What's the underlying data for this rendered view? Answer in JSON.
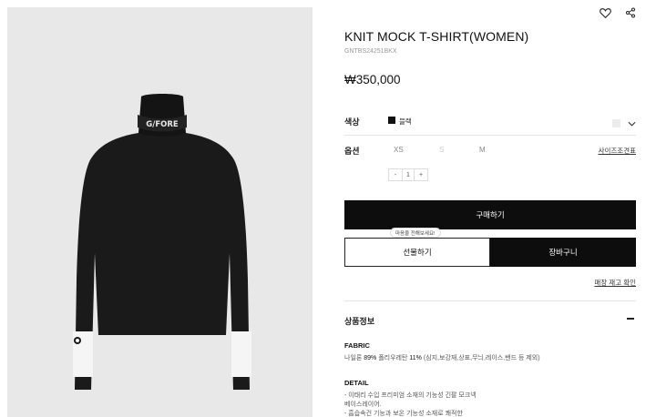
{
  "product": {
    "name": "KNIT MOCK T-SHIRT(WOMEN)",
    "code": "GNTBS24251BKX",
    "price": "₩350,000",
    "collar_print": "G/FORE"
  },
  "options": {
    "color_label": "색상",
    "color_value": "블랙",
    "size_label": "옵션",
    "sizes": [
      "XS",
      "S",
      "M"
    ],
    "size_guide": "사이즈조견표",
    "quantity": "1",
    "qty_minus": "-",
    "qty_plus": "+"
  },
  "actions": {
    "buy": "구매하기",
    "gift_tooltip": "마음을 전해보세요!",
    "gift": "선물하기",
    "cart": "장바구니",
    "store_stock": "매장 재고 확인"
  },
  "details": {
    "section_title": "상품정보",
    "fabric_heading": "FABRIC",
    "fabric_text_pre": "나일론 ",
    "fabric_pct1": "89%",
    "fabric_text_mid": " 폴리우레탄 ",
    "fabric_pct2": "11%",
    "fabric_text_post": " (심지,보강재,상표,무늬,레이스,밴드 등 제외)",
    "detail_heading": "DETAIL",
    "detail_lines": [
      "- 이태리 수입 프리미엄 소재의 기능성 긴팔 모크넥",
      "  베이스레이어.",
      "- 흡습속건 기능과 보온 기능성 소재로 쾌적한"
    ]
  },
  "icons": {
    "wishlist": "heart-icon",
    "share": "share-icon",
    "dropdown": "chevron-down-icon"
  }
}
